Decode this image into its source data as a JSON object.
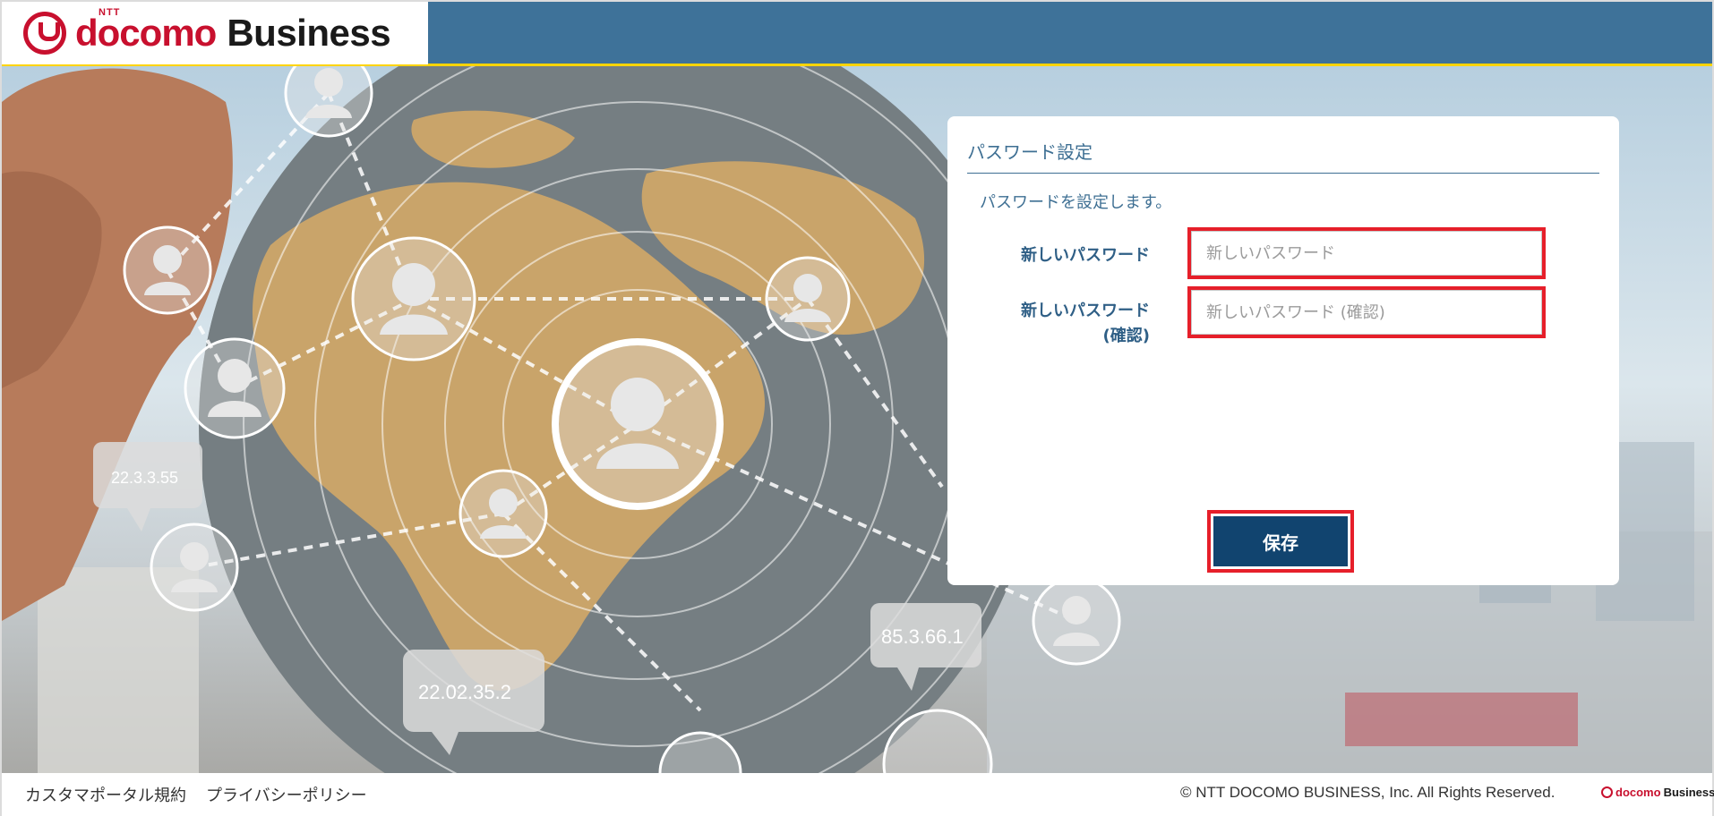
{
  "header": {
    "brand_ntt": "NTT",
    "brand_docomo": "docomo",
    "brand_business": "Business"
  },
  "background": {
    "labels": [
      "22.3.3.55",
      "22.02.35.2",
      "85.3.66.1"
    ]
  },
  "panel": {
    "title": "パスワード設定",
    "description": "パスワードを設定します。",
    "new_password": {
      "label": "新しいパスワード",
      "placeholder": "新しいパスワード",
      "value": ""
    },
    "confirm_password": {
      "label_line1": "新しいパスワード",
      "label_line2": "(確認)",
      "placeholder": "新しいパスワード (確認)",
      "value": ""
    },
    "save_label": "保存"
  },
  "footer": {
    "links": [
      "カスタマポータル規約",
      "プライバシーポリシー"
    ],
    "copyright": "© NTT DOCOMO BUSINESS, Inc. All Rights Reserved.",
    "logo_docomo": "docomo",
    "logo_business": "Business"
  },
  "colors": {
    "header_bg": "#3e7299",
    "header_accent": "#ffd400",
    "brand_red": "#c8102e",
    "title_blue": "#3e6f93",
    "button_bg": "#11446f",
    "highlight_red": "#e61f2a"
  }
}
